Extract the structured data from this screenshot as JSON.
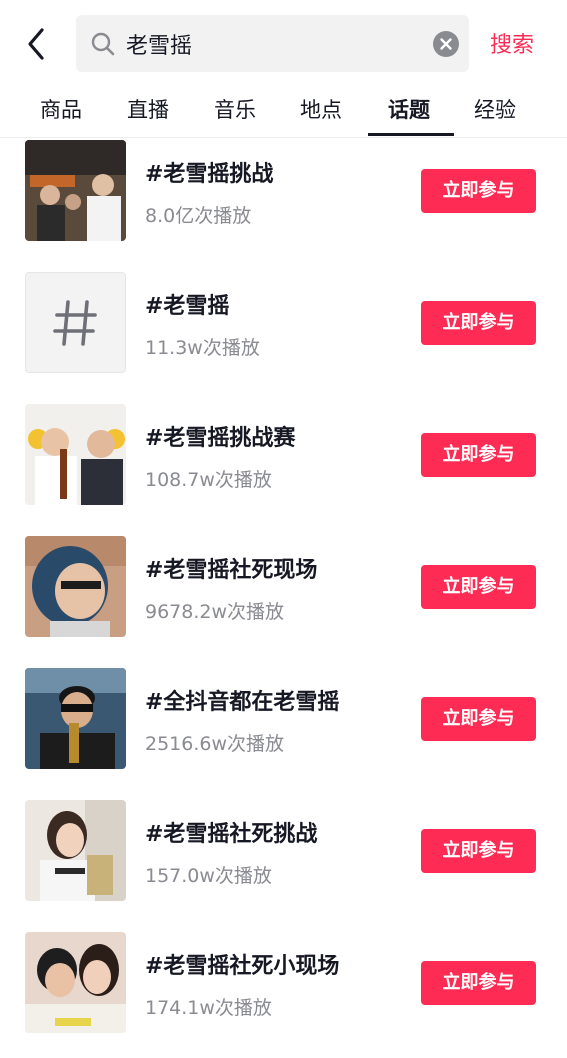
{
  "search": {
    "query": "老雪摇",
    "submit_label": "搜索"
  },
  "tabs": [
    {
      "label": "商品",
      "active": false
    },
    {
      "label": "直播",
      "active": false
    },
    {
      "label": "音乐",
      "active": false
    },
    {
      "label": "地点",
      "active": false
    },
    {
      "label": "话题",
      "active": true
    },
    {
      "label": "经验",
      "active": false
    }
  ],
  "colors": {
    "accent": "#fe2c55",
    "text": "#161823",
    "secondary_text": "#8a8b91"
  },
  "topics": [
    {
      "title": "#老雪摇挑战",
      "plays": "8.0亿次播放",
      "button": "立即参与",
      "thumb_icon": "photo-thumb"
    },
    {
      "title": "#老雪摇",
      "plays": "11.3w次播放",
      "button": "立即参与",
      "thumb_icon": "hashtag-icon"
    },
    {
      "title": "#老雪摇挑战赛",
      "plays": "108.7w次播放",
      "button": "立即参与",
      "thumb_icon": "photo-thumb"
    },
    {
      "title": "#老雪摇社死现场",
      "plays": "9678.2w次播放",
      "button": "立即参与",
      "thumb_icon": "photo-thumb"
    },
    {
      "title": "#全抖音都在老雪摇",
      "plays": "2516.6w次播放",
      "button": "立即参与",
      "thumb_icon": "photo-thumb"
    },
    {
      "title": "#老雪摇社死挑战",
      "plays": "157.0w次播放",
      "button": "立即参与",
      "thumb_icon": "photo-thumb"
    },
    {
      "title": "#老雪摇社死小现场",
      "plays": "174.1w次播放",
      "button": "立即参与",
      "thumb_icon": "photo-thumb"
    }
  ]
}
